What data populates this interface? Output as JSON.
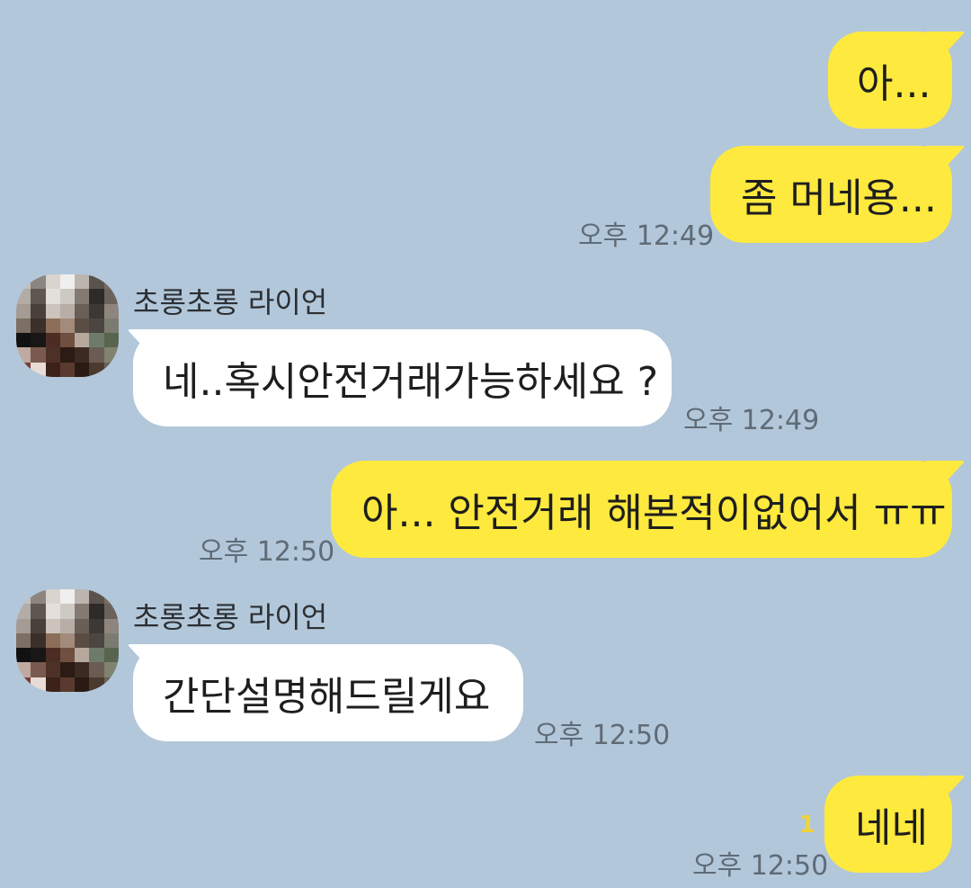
{
  "messages": {
    "m1": {
      "text": "아..."
    },
    "m2": {
      "text": "좀 머네용...",
      "time": "오후 12:49"
    },
    "m3": {
      "sender": "초롱초롱 라이언",
      "text": "네..혹시안전거래가능하세요 ?",
      "time": "오후 12:49"
    },
    "m4": {
      "text": "아... 안전거래 해본적이없어서 ㅠㅠ",
      "time": "오후 12:50"
    },
    "m5": {
      "sender": "초롱초롱 라이언",
      "text": "간단설명해드릴게요",
      "time": "오후 12:50"
    },
    "m6": {
      "text": "네네",
      "time": "오후 12:50",
      "unread": "1"
    }
  },
  "colors": {
    "background": "#b2c7da",
    "outgoing_bubble": "#fee93e",
    "incoming_bubble": "#ffffff",
    "timestamp": "#5f6b76",
    "unread_count": "#f0d23a"
  },
  "icons": {
    "avatar": "pixelated-profile-photo",
    "bubble_tail": "speech-tail"
  }
}
